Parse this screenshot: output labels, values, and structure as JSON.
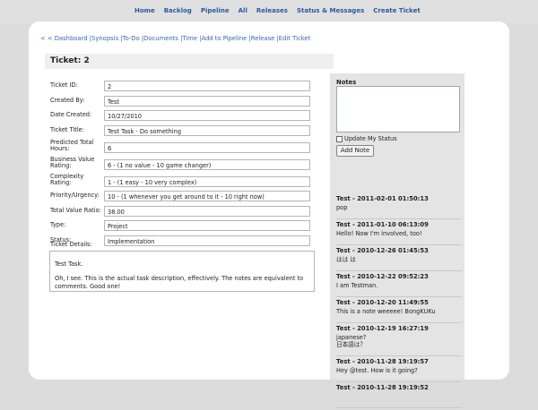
{
  "topnav": {
    "items": [
      "Home",
      "Backlog",
      "Pipeline",
      "All",
      "Releases",
      "Status & Messages",
      "Create Ticket"
    ]
  },
  "subnav": {
    "text": "< < Dashboard |Synopsis |To-Do |Documents |Time |Add to Pipeline |Release |Edit Ticket"
  },
  "ticket": {
    "heading": "Ticket: 2",
    "fields": [
      {
        "label": "Ticket ID:",
        "value": "2"
      },
      {
        "label": "Created By:",
        "value": "Test"
      },
      {
        "label": "Date Created:",
        "value": "10/27/2010"
      },
      {
        "label": "Ticket Title:",
        "value": "Test Task - Do something"
      },
      {
        "label": "Predicted Total Hours:",
        "value": "6"
      },
      {
        "label": "Business Value Rating:",
        "value": "6 - (1 no value - 10 game changer)"
      },
      {
        "label": "Complexity Rating:",
        "value": "1 - (1 easy - 10 very complex)"
      },
      {
        "label": "Priority/Urgency:",
        "value": "10 - (1 whenever you get around to it - 10 right now)"
      },
      {
        "label": "Total Value Ratio:",
        "value": "38.00"
      },
      {
        "label": "Type:",
        "value": "Project"
      },
      {
        "label": "Status:",
        "value": "Implementation"
      }
    ],
    "details_label": "Ticket Details:",
    "details": [
      "Test Task.",
      "Oh, I see. This is the actual task description, effectively. The notes are equivalent to comments. Good one!"
    ]
  },
  "notes": {
    "title": "Notes",
    "update_status_label": "Update My Status",
    "add_button": "Add Note",
    "items": [
      {
        "header": "Test - 2011-02-01 01:50:13",
        "body": "pop"
      },
      {
        "header": "Test - 2011-01-10 06:13:09",
        "body": "Hello! Now I'm involved, too!"
      },
      {
        "header": "Test - 2010-12-26 01:45:53",
        "body": "はは は"
      },
      {
        "header": "Test - 2010-12-22 09:52:23",
        "body": "I am Testman."
      },
      {
        "header": "Test - 2010-12-20 11:49:55",
        "body": "This is a note weeeee! BongKUKu"
      },
      {
        "header": "Test - 2010-12-19 16:27:19",
        "body": "japanese?\n日本語は？"
      },
      {
        "header": "Test - 2010-11-28 19:19:57",
        "body": "Hey @test. How is it going?"
      },
      {
        "header": "Test - 2010-11-28 19:19:52",
        "body": ""
      }
    ]
  }
}
